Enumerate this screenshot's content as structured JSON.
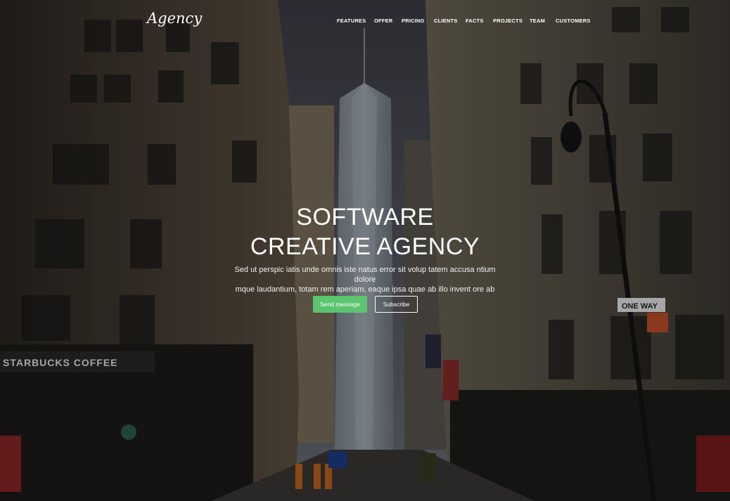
{
  "brand": {
    "logo": "Agency"
  },
  "nav": {
    "items": [
      "FEATURES",
      "OFFER",
      "PRICING",
      "CLIENTS",
      "FACTS",
      "PROJECTS",
      "TEAM",
      "CUSTOMERS"
    ]
  },
  "hero": {
    "title_line1": "SOFTWARE",
    "title_line2": "CREATIVE AGENCY",
    "lead_line1": "Sed ut perspic iatis unde omnis iste natus error sit volup tatem accusa ntium dolore",
    "lead_line2": "mque laudantium, totam rem aperiam, eaque ipsa quae ab illo invent ore ab",
    "primary_button": "Send message",
    "secondary_button": "Subscribe",
    "background_storefront_sign": "STARBUCKS COFFEE",
    "background_street_sign": "ONE WAY"
  },
  "colors": {
    "accent": "#5cc46f",
    "text": "#ffffff"
  }
}
